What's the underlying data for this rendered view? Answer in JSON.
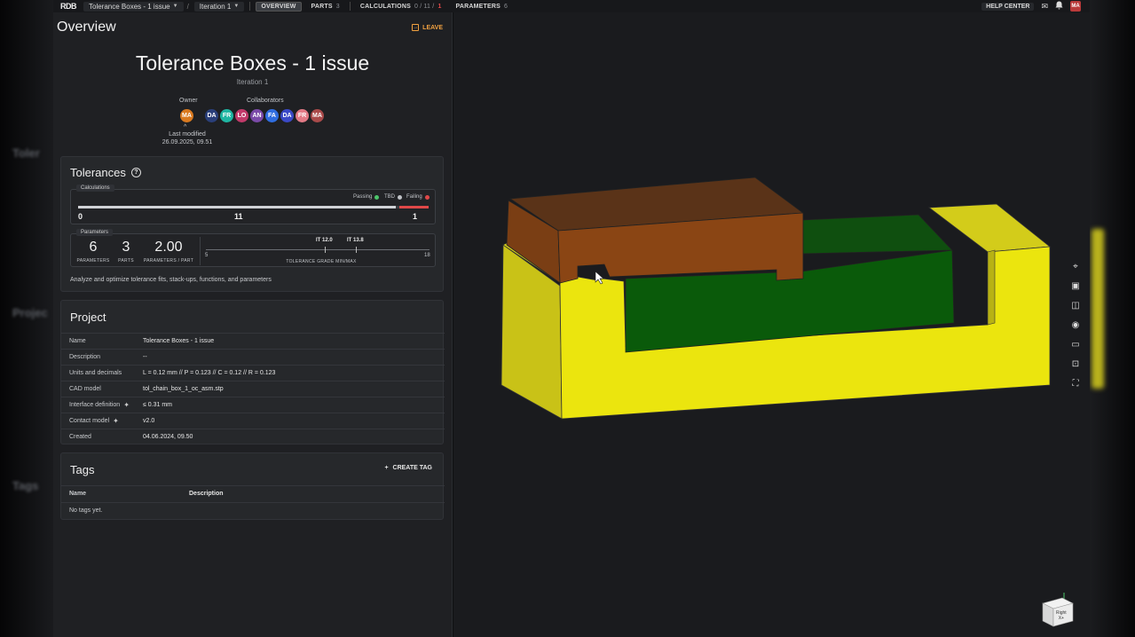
{
  "topbar": {
    "logo": "RDB",
    "project": "Tolerance Boxes - 1 issue",
    "iteration": "Iteration 1",
    "tabs": [
      {
        "label": "OVERVIEW",
        "count": ""
      },
      {
        "label": "PARTS",
        "count": "3"
      },
      {
        "label": "CALCULATIONS",
        "count": "0 / 11 /",
        "fail": "1"
      },
      {
        "label": "PARAMETERS",
        "count": "6"
      }
    ],
    "help": "HELP CENTER",
    "user_initials": "MA"
  },
  "overview": {
    "title": "Overview",
    "leave": "LEAVE",
    "project_title": "Tolerance Boxes - 1 issue",
    "iteration": "Iteration 1",
    "owner_label": "Owner",
    "owner": {
      "initials": "MA",
      "color": "#d9791f"
    },
    "collaborators_label": "Collaborators",
    "collaborators": [
      {
        "initials": "DA",
        "color": "#2a3f7a"
      },
      {
        "initials": "FR",
        "color": "#1fb5a2"
      },
      {
        "initials": "LO",
        "color": "#c13a6a"
      },
      {
        "initials": "AN",
        "color": "#7b4aa8"
      },
      {
        "initials": "FA",
        "color": "#2f6de0"
      },
      {
        "initials": "DA",
        "color": "#3a49c6"
      },
      {
        "initials": "FR",
        "color": "#e27a86"
      },
      {
        "initials": "MA",
        "color": "#a94a4a"
      }
    ],
    "last_modified_label": "Last modified",
    "last_modified": "26.09.2025, 09.51"
  },
  "tolerances": {
    "title": "Tolerances",
    "calc_legend": "Calculations",
    "status": {
      "passing": "Passing",
      "tbd": "TBD",
      "failing": "Failing"
    },
    "colors": {
      "passing": "#4cc46a",
      "tbd": "#bfc2c6",
      "failing": "#e04848"
    },
    "counts": {
      "passing": "0",
      "tbd": "11",
      "failing": "1"
    },
    "failing_fraction": 0.083,
    "params_legend": "Parameters",
    "parameters": "6",
    "parameters_label": "PARAMETERS",
    "parts": "3",
    "parts_label": "PARTS",
    "per_part": "2.00",
    "per_part_label": "PARAMETERS / PART",
    "grade_min": "IT 12.0",
    "grade_max": "IT 13.8",
    "scale_min": "5",
    "scale_max": "18",
    "grade_label": "TOLERANCE GRADE MIN/MAX",
    "description": "Analyze and optimize tolerance fits, stack-ups, functions, and parameters"
  },
  "project": {
    "title": "Project",
    "rows": [
      {
        "key": "Name",
        "value": "Tolerance Boxes - 1 issue"
      },
      {
        "key": "Description",
        "value": "--"
      },
      {
        "key": "Units and decimals",
        "value": "L = 0.12 mm // P = 0.123 // C = 0.12 // R = 0.123"
      },
      {
        "key": "CAD model",
        "value": "tol_chain_box_1_oc_asm.stp"
      },
      {
        "key": "Interface definition",
        "value": "≤ 0.31 mm"
      },
      {
        "key": "Contact model",
        "value": "v2.0"
      },
      {
        "key": "Created",
        "value": "04.06.2024, 09.50"
      }
    ]
  },
  "tags": {
    "title": "Tags",
    "create": "CREATE TAG",
    "col_name": "Name",
    "col_desc": "Description",
    "empty": "No tags yet."
  },
  "viewcube": {
    "face": "Right",
    "axis_x": "X+"
  }
}
